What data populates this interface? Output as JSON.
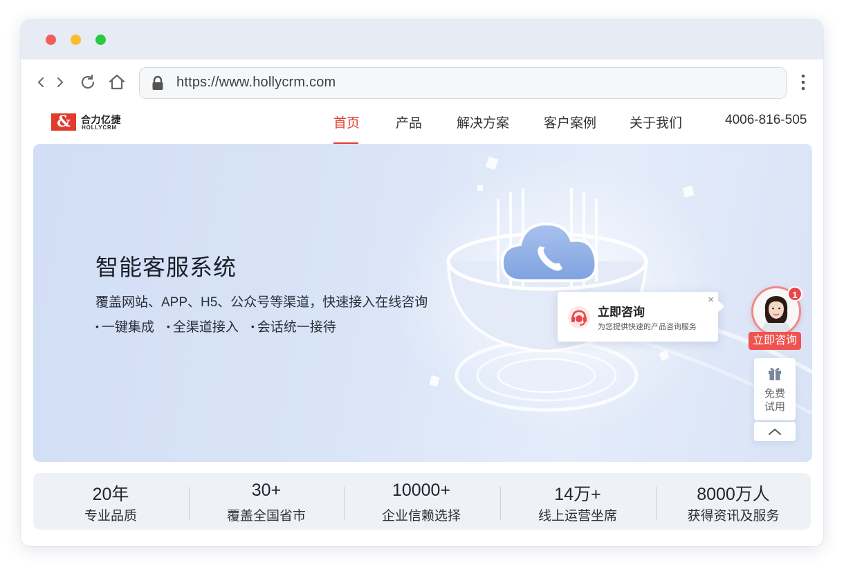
{
  "browser": {
    "url": "https://www.hollycrm.com",
    "icons": [
      "back-icon",
      "forward-icon",
      "reload-icon",
      "home-icon",
      "lock-icon",
      "more-icon"
    ]
  },
  "site": {
    "logo_cn": "合力亿捷",
    "logo_en": "HOLLYCRM",
    "logo_mark": "&",
    "menu": [
      {
        "label": "首页",
        "active": true
      },
      {
        "label": "产品",
        "active": false
      },
      {
        "label": "解决方案",
        "active": false
      },
      {
        "label": "客户案例",
        "active": false
      },
      {
        "label": "关于我们",
        "active": false
      }
    ],
    "phone": "4006-816-505",
    "accent": "#e23b2e"
  },
  "banner": {
    "title": "智能客服系统",
    "subtitle": "覆盖网站、APP、H5、公众号等渠道，快速接入在线咨询",
    "features": [
      "一键集成",
      "全渠道接入",
      "会话统一接待"
    ]
  },
  "consult_popup": {
    "title": "立即咨询",
    "description": "为您提供快速的产品咨询服务",
    "close": "×"
  },
  "float_tools": {
    "badge": "1",
    "consult_label": "立即咨询",
    "trial_line1": "免费",
    "trial_line2": "试用"
  },
  "stats": [
    {
      "value": "20年",
      "label": "专业品质"
    },
    {
      "value": "30+",
      "label": "覆盖全国省市"
    },
    {
      "value": "10000+",
      "label": "企业信赖选择"
    },
    {
      "value": "14万+",
      "label": "线上运营坐席"
    },
    {
      "value": "8000万人",
      "label": "获得资讯及服务"
    }
  ]
}
